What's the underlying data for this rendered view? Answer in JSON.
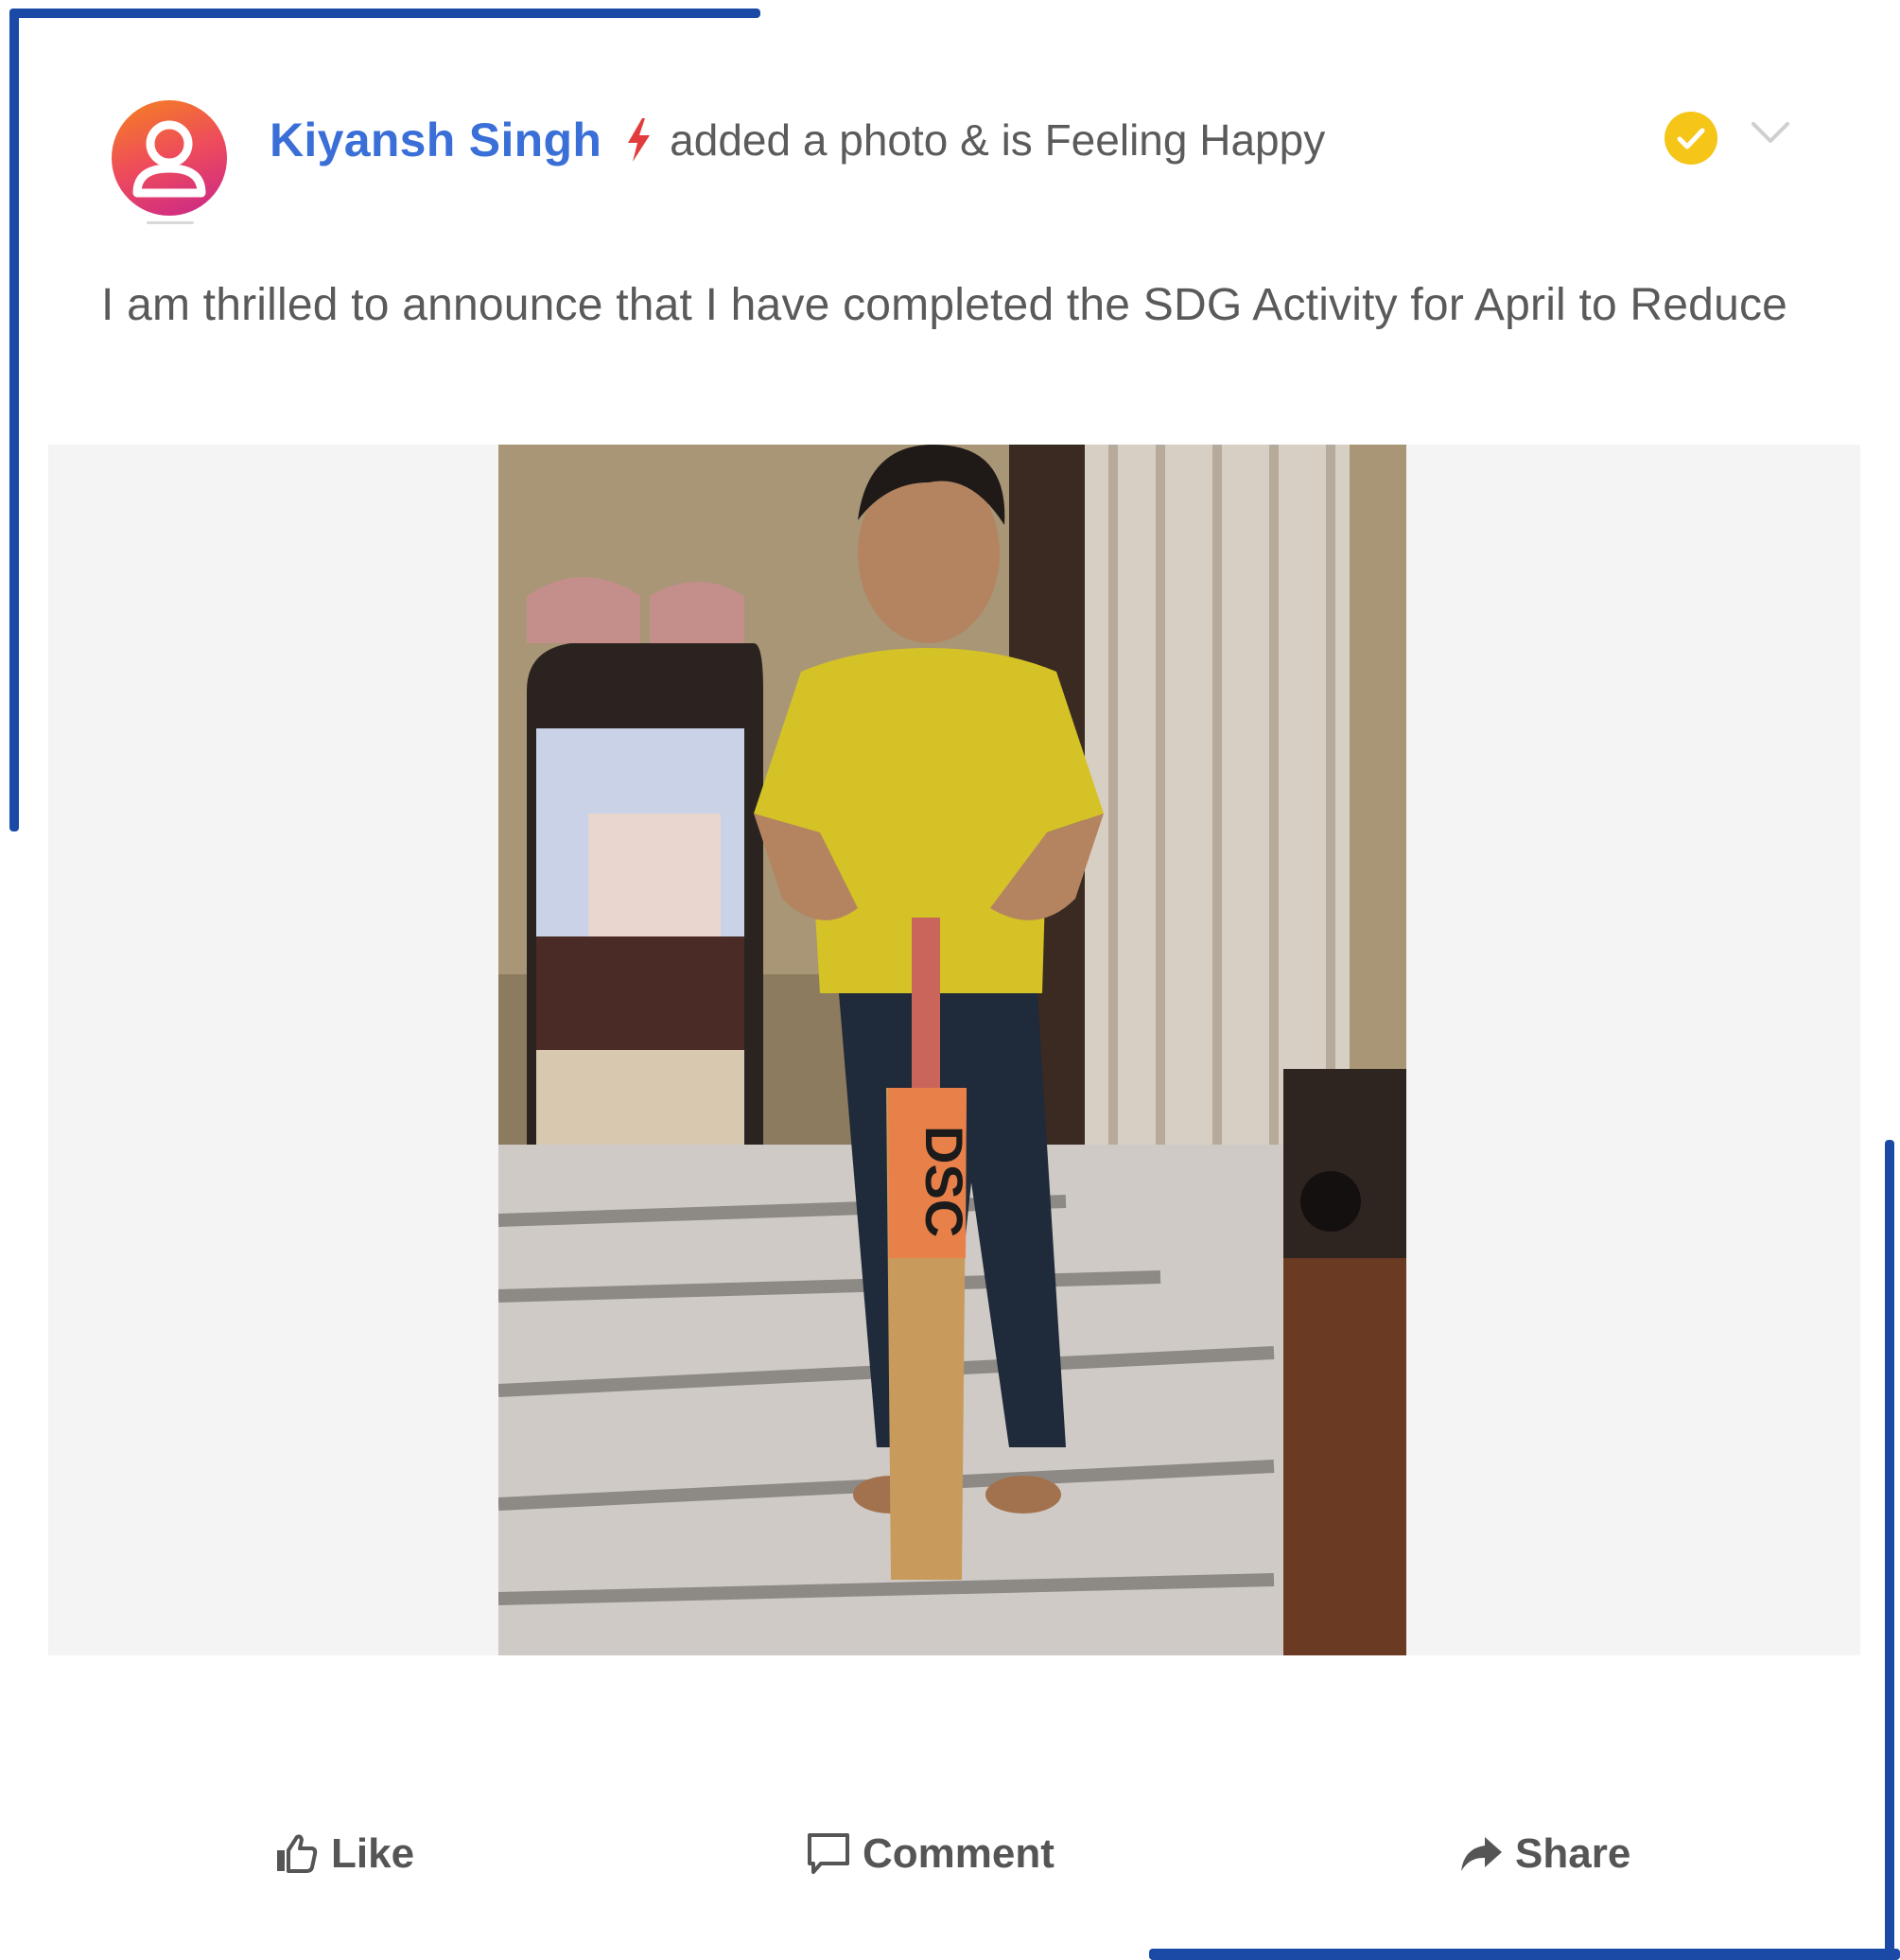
{
  "post": {
    "author": "Kiyansh Singh",
    "activity": "added a photo & is Feeling Happy",
    "text": "I am thrilled to announce that I have completed the SDG Activity for April to Reduce"
  },
  "photo": {
    "bat_brand": "DSC"
  },
  "actions": {
    "like_label": "Like",
    "comment_label": "Comment",
    "share_label": "Share"
  },
  "colors": {
    "frame": "#1b4aa6",
    "author_name": "#3b6fd8",
    "verified_badge": "#f5c518",
    "bolt": "#e23b3b"
  },
  "icons": {
    "avatar": "user-avatar-icon",
    "bolt": "lightning-bolt-icon",
    "verified": "verified-check-icon",
    "menu": "chevron-down-icon",
    "like": "thumbs-up-icon",
    "comment": "comment-bubble-icon",
    "share": "share-arrow-icon"
  }
}
